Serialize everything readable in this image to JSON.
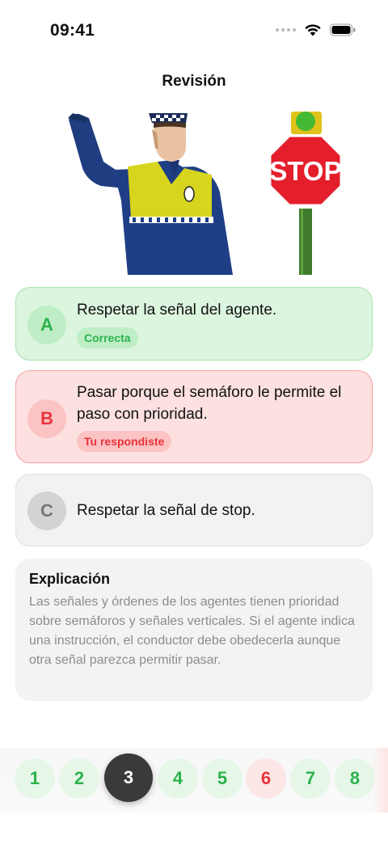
{
  "status_bar": {
    "time": "09:41"
  },
  "nav": {
    "title": "Revisión"
  },
  "question_image": {
    "sign_text": "STOP"
  },
  "options": [
    {
      "letter": "A",
      "text": "Respetar la señal del agente.",
      "badge": "Correcta",
      "state": "correct"
    },
    {
      "letter": "B",
      "text": "Pasar porque el semáforo le permite el paso con prioridad.",
      "badge": "Tu respondiste",
      "state": "wrong"
    },
    {
      "letter": "C",
      "text": "Respetar la señal de stop.",
      "badge": "",
      "state": "neutral"
    }
  ],
  "explanation": {
    "title": "Explicación",
    "body": "Las señales y órdenes de los agentes tienen prioridad sobre semáforos y señales verticales. Si el agente indica una instrucción, el conductor debe obedecerla aunque otra señal parezca permitir pasar."
  },
  "pager": {
    "items": [
      {
        "label": "1",
        "state": "correct"
      },
      {
        "label": "2",
        "state": "correct"
      },
      {
        "label": "3",
        "state": "current"
      },
      {
        "label": "4",
        "state": "correct"
      },
      {
        "label": "5",
        "state": "correct"
      },
      {
        "label": "6",
        "state": "wrong"
      },
      {
        "label": "7",
        "state": "correct"
      },
      {
        "label": "8",
        "state": "correct"
      }
    ]
  },
  "colors": {
    "correct": "#2bb24c",
    "wrong": "#e8333b",
    "current": "#3a3a3a"
  }
}
